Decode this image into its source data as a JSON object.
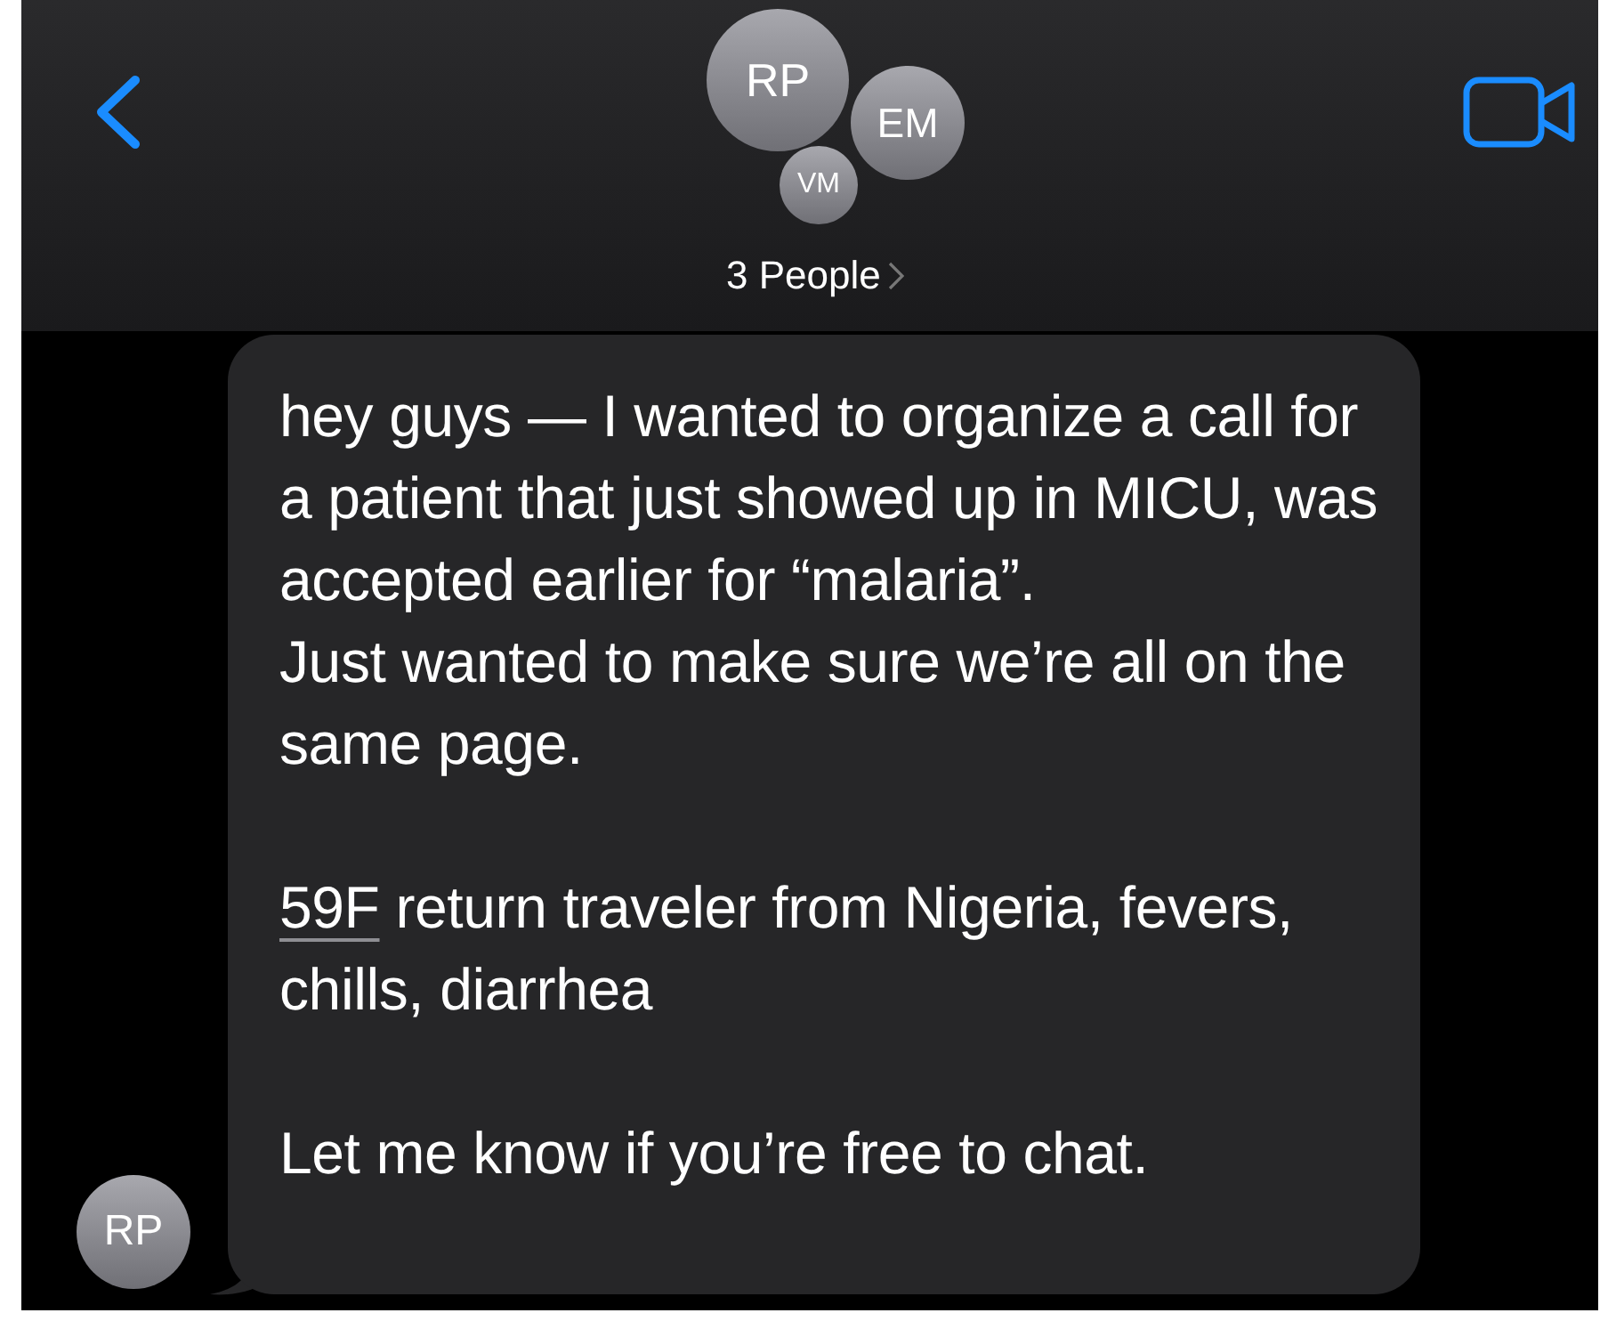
{
  "header": {
    "avatars": [
      {
        "initials": "RP"
      },
      {
        "initials": "EM"
      },
      {
        "initials": "VM"
      }
    ],
    "title": "3 People"
  },
  "message": {
    "sender_initials": "RP",
    "blocks": [
      [
        {
          "kind": "text",
          "text": "hey guys — I wanted to organize a call for a patient that just showed up in MICU, was accepted earlier for “malaria”."
        },
        {
          "kind": "text",
          "text": "Just wanted to make sure we’re all on the same page."
        }
      ],
      [
        {
          "kind": "detected",
          "link": "59F",
          "text": " return traveler from Nigeria, fevers, chills, diarrhea"
        }
      ],
      [
        {
          "kind": "text",
          "text": "Let me know if you’re free to chat."
        }
      ]
    ]
  }
}
